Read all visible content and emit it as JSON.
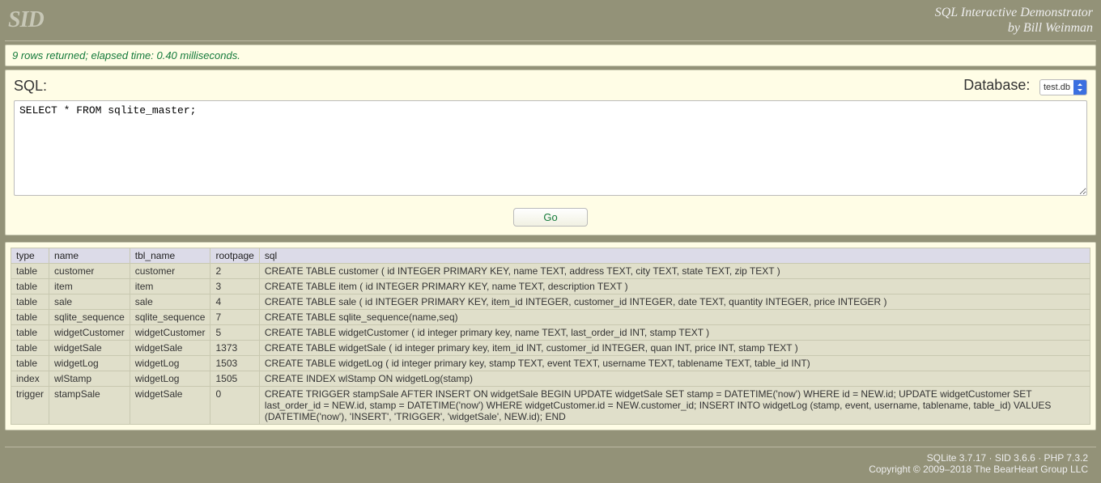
{
  "header": {
    "logo": "SID",
    "title": "SQL Interactive Demonstrator",
    "byline": "by Bill Weinman"
  },
  "status": "9 rows returned; elapsed time: 0.40 milliseconds.",
  "panel": {
    "sql_label": "SQL:",
    "db_label": "Database:",
    "db_selected": "test.db",
    "sql_value": "SELECT * FROM sqlite_master;",
    "go_label": "Go"
  },
  "results": {
    "headers": [
      "type",
      "name",
      "tbl_name",
      "rootpage",
      "sql"
    ],
    "rows": [
      [
        "table",
        "customer",
        "customer",
        "2",
        "CREATE TABLE customer ( id INTEGER PRIMARY KEY, name TEXT, address TEXT, city TEXT, state TEXT, zip TEXT )"
      ],
      [
        "table",
        "item",
        "item",
        "3",
        "CREATE TABLE item ( id INTEGER PRIMARY KEY, name TEXT, description TEXT )"
      ],
      [
        "table",
        "sale",
        "sale",
        "4",
        "CREATE TABLE sale ( id INTEGER PRIMARY KEY, item_id INTEGER, customer_id INTEGER, date TEXT, quantity INTEGER, price INTEGER )"
      ],
      [
        "table",
        "sqlite_sequence",
        "sqlite_sequence",
        "7",
        "CREATE TABLE sqlite_sequence(name,seq)"
      ],
      [
        "table",
        "widgetCustomer",
        "widgetCustomer",
        "5",
        "CREATE TABLE widgetCustomer ( id integer primary key, name TEXT, last_order_id INT, stamp TEXT )"
      ],
      [
        "table",
        "widgetSale",
        "widgetSale",
        "1373",
        "CREATE TABLE widgetSale ( id integer primary key, item_id INT, customer_id INTEGER, quan INT, price INT, stamp TEXT )"
      ],
      [
        "table",
        "widgetLog",
        "widgetLog",
        "1503",
        "CREATE TABLE widgetLog ( id integer primary key, stamp TEXT, event TEXT, username TEXT, tablename TEXT, table_id INT)"
      ],
      [
        "index",
        "wlStamp",
        "widgetLog",
        "1505",
        "CREATE INDEX wlStamp ON widgetLog(stamp)"
      ],
      [
        "trigger",
        "stampSale",
        "widgetSale",
        "0",
        "CREATE TRIGGER stampSale AFTER INSERT ON widgetSale BEGIN UPDATE widgetSale SET stamp = DATETIME('now') WHERE id = NEW.id; UPDATE widgetCustomer SET last_order_id = NEW.id, stamp = DATETIME('now') WHERE widgetCustomer.id = NEW.customer_id; INSERT INTO widgetLog (stamp, event, username, tablename, table_id) VALUES (DATETIME('now'), 'INSERT', 'TRIGGER', 'widgetSale', NEW.id); END"
      ]
    ]
  },
  "footer": {
    "line1": "SQLite 3.7.17 · SID 3.6.6 · PHP 7.3.2",
    "line2": "Copyright © 2009–2018 The BearHeart Group LLC"
  }
}
